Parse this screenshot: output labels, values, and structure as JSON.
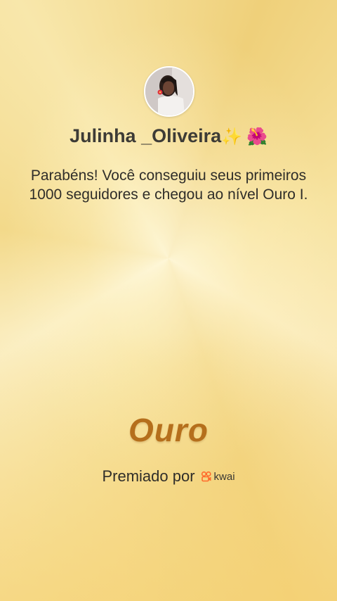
{
  "profile": {
    "username": "Julinha _Oliveira",
    "emoji_1": "✨",
    "emoji_2": "🌺"
  },
  "message": "Parabéns! Você conseguiu seus primeiros 1000 seguidores e chegou ao nível Ouro I.",
  "level": {
    "label": "Ouro"
  },
  "footer": {
    "awarded_by": "Premiado por",
    "brand_name": "kwai",
    "brand_color": "#ff6a2b"
  },
  "colors": {
    "level_text": "#b56f1c",
    "background": "#f6dc8a"
  }
}
